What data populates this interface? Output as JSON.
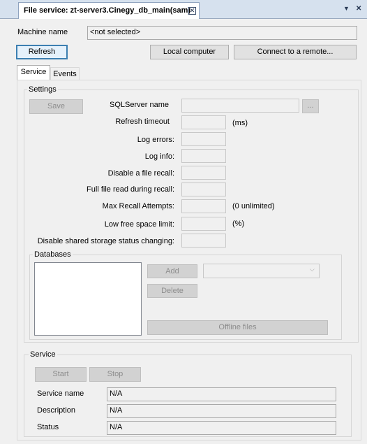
{
  "window": {
    "doc_tab_title": "File service: zt-server3.Cinegy_db_main(sam)",
    "close_glyph": "✕",
    "dropdown_glyph": "▼",
    "pin_glyph": "✕"
  },
  "machine": {
    "label": "Machine name",
    "value": "<not selected>"
  },
  "toolbar": {
    "refresh": "Refresh",
    "local_computer": "Local computer",
    "connect_remote": "Connect to a remote..."
  },
  "tabs": [
    {
      "label": "Service",
      "active": true
    },
    {
      "label": "Events",
      "active": false
    }
  ],
  "settings": {
    "group_title": "Settings",
    "save": "Save",
    "sqlserver_label": "SQLServer name",
    "browse": "...",
    "refresh_timeout_label": "Refresh timeout",
    "refresh_timeout_unit": "(ms)",
    "log_errors_label": "Log errors:",
    "log_info_label": "Log info:",
    "disable_recall_label": "Disable a file recall:",
    "full_read_label": "Full file read during recall:",
    "max_recall_label": "Max Recall Attempts:",
    "max_recall_unit": "(0 unlimited)",
    "low_space_label": "Low free space limit:",
    "low_space_unit": "(%)",
    "disable_shared_label": "Disable shared storage status changing:"
  },
  "databases": {
    "group_title": "Databases",
    "add": "Add",
    "delete": "Delete",
    "offline_files": "Offline files",
    "combo_arrow": "⌵"
  },
  "service": {
    "group_title": "Service",
    "start": "Start",
    "stop": "Stop",
    "service_name_label": "Service name",
    "service_name_value": "N/A",
    "description_label": "Description",
    "description_value": "N/A",
    "status_label": "Status",
    "status_value": "N/A"
  }
}
